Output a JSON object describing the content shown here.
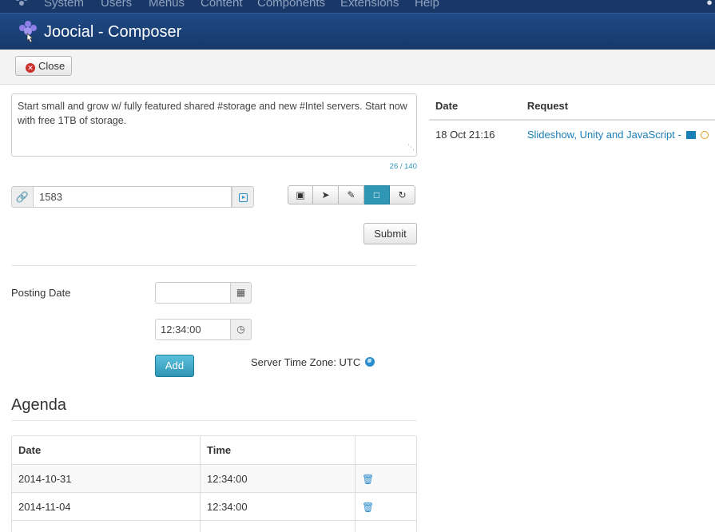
{
  "top_menu": {
    "items": [
      "System",
      "Users",
      "Menus",
      "Content",
      "Components",
      "Extensions",
      "Help"
    ]
  },
  "header": {
    "title": "Joocial - Composer"
  },
  "toolbar": {
    "close_label": "Close"
  },
  "composer": {
    "message": "Start small and grow w/ fully featured shared #storage and new #Intel servers. Start now with free 1TB of storage.",
    "char_counter": "26 / 140",
    "url_value": "1583",
    "submit_label": "Submit"
  },
  "schedule": {
    "posting_date_label": "Posting Date",
    "date_value": "",
    "time_value": "12:34:00",
    "add_label": "Add",
    "timezone_text": "Server Time Zone: UTC"
  },
  "agenda": {
    "title": "Agenda",
    "columns": [
      "Date",
      "Time",
      ""
    ],
    "rows": [
      {
        "date": "2014-10-31",
        "time": "12:34:00"
      },
      {
        "date": "2014-11-04",
        "time": "12:34:00"
      }
    ]
  },
  "requests": {
    "columns": [
      "Date",
      "Request"
    ],
    "rows": [
      {
        "date": "18 Oct 21:16",
        "request": "Slideshow, Unity and JavaScript -"
      }
    ]
  },
  "colors": {
    "header": "#1f4a85",
    "accent": "#2f96b4",
    "link": "#1a7fb9",
    "danger": "#c9302c"
  }
}
